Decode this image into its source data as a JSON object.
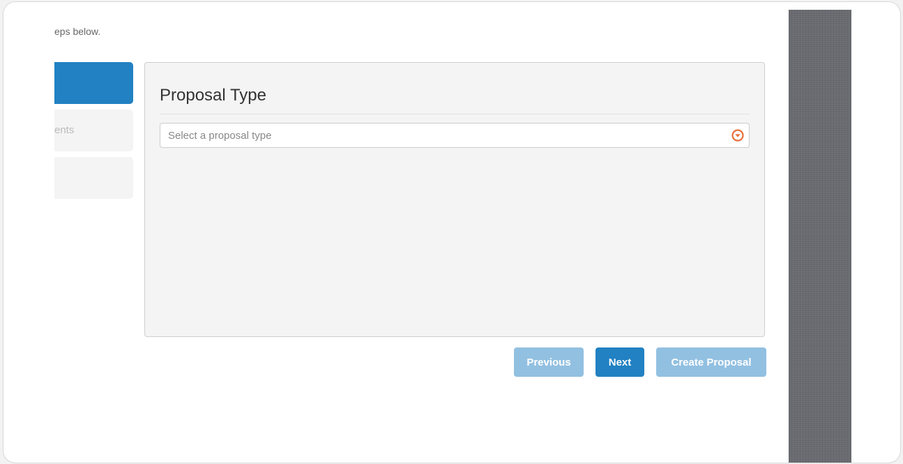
{
  "intro": {
    "text": "eps below."
  },
  "steps": [
    {
      "label": "",
      "active": true
    },
    {
      "label": "ents",
      "active": false
    },
    {
      "label": "",
      "active": false
    }
  ],
  "panel": {
    "title": "Proposal Type",
    "select": {
      "placeholder": "Select a proposal type",
      "value": "",
      "icon": "chevron-down-circle-icon"
    }
  },
  "buttons": {
    "previous": "Previous",
    "next": "Next",
    "create": "Create Proposal"
  },
  "colors": {
    "primary": "#2181c2",
    "primary_disabled": "#92c0e1",
    "arrow_accent": "#e8703a",
    "sidebar_texture": "#6a6b70"
  }
}
